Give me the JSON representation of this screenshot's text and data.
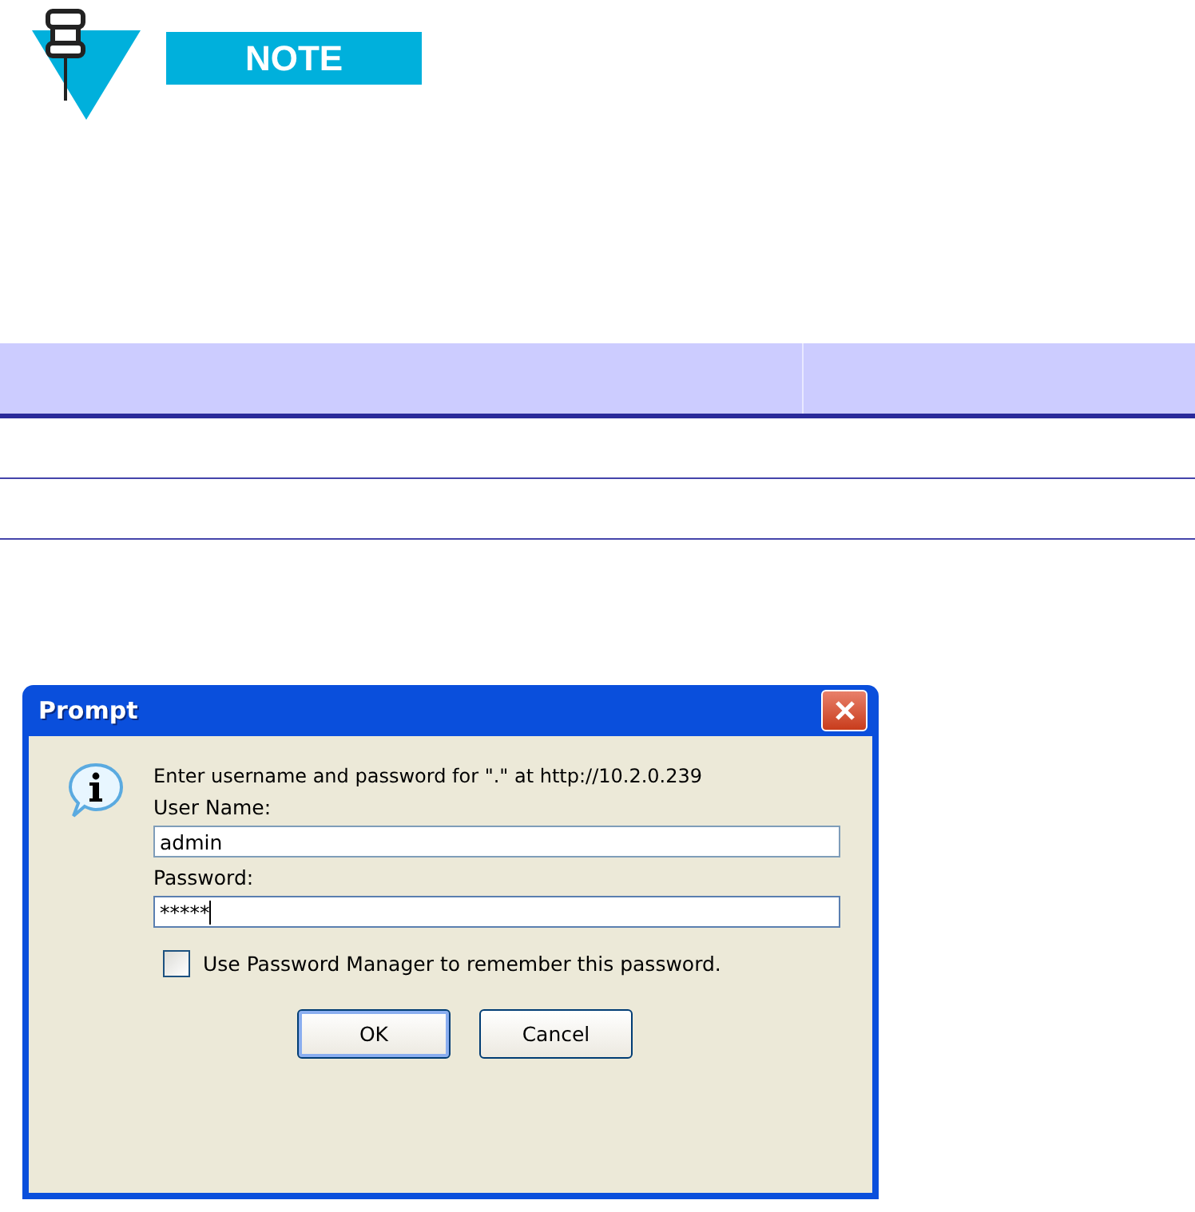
{
  "note": {
    "label": "NOTE"
  },
  "dialog": {
    "title": "Prompt",
    "message": "Enter username and password for \".\" at http://10.2.0.239",
    "fields": [
      {
        "label": "User Name:",
        "value": "admin",
        "focused": false
      },
      {
        "label": "Password:",
        "value": "*****",
        "focused": true
      }
    ],
    "checkbox": {
      "label": "Use Password Manager to remember this password.",
      "checked": false
    },
    "buttons": [
      {
        "label": "OK",
        "default": true
      },
      {
        "label": "Cancel",
        "default": false
      }
    ]
  }
}
